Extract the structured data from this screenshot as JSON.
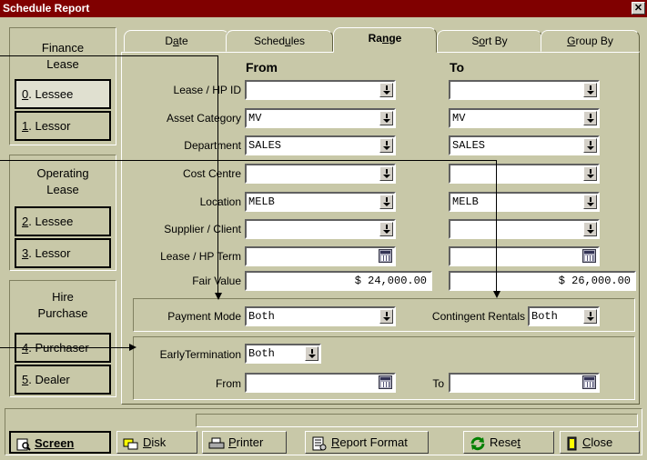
{
  "window": {
    "title": "Schedule Report",
    "close_glyph": "✕"
  },
  "sidebar": {
    "finance": {
      "title_line1": "Finance",
      "title_line2": "Lease",
      "btn1": {
        "key": "0",
        "label": ". Lessee"
      },
      "btn2": {
        "key": "1",
        "label": ". Lessor"
      }
    },
    "operating": {
      "title_line1": "Operating",
      "title_line2": "Lease",
      "btn1": {
        "key": "2",
        "label": ". Lessee"
      },
      "btn2": {
        "key": "3",
        "label": ". Lessor"
      }
    },
    "hire": {
      "title_line1": "Hire",
      "title_line2": "Purchase",
      "btn1": {
        "key": "4",
        "label": ". Purchaser"
      },
      "btn2": {
        "key": "5",
        "label": ". Dealer"
      }
    }
  },
  "tabs": [
    {
      "pre": "D",
      "key": "a",
      "post": "te"
    },
    {
      "pre": "Sched",
      "key": "u",
      "post": "les"
    },
    {
      "pre": "Ra",
      "key": "n",
      "post": "ge"
    },
    {
      "pre": "S",
      "key": "o",
      "post": "rt By"
    },
    {
      "pre": "",
      "key": "G",
      "post": "roup By"
    }
  ],
  "range": {
    "from_header": "From",
    "to_header": "To",
    "rows": [
      {
        "label": "Lease / HP ID",
        "from": "",
        "to": ""
      },
      {
        "label": "Asset Category",
        "from": "MV",
        "to": "MV"
      },
      {
        "label": "Department",
        "from": "SALES",
        "to": "SALES"
      },
      {
        "label": "Cost Centre",
        "from": "",
        "to": ""
      },
      {
        "label": "Location",
        "from": "MELB",
        "to": "MELB"
      },
      {
        "label": "Supplier / Client",
        "from": "",
        "to": ""
      },
      {
        "label": "Lease / HP Term",
        "from": "",
        "to": ""
      },
      {
        "label": "Fair Value",
        "from": "$ 24,000.00",
        "to": "$ 26,000.00"
      }
    ],
    "payment_mode": {
      "label": "Payment Mode",
      "value": "Both"
    },
    "contingent_rentals": {
      "label": "Contingent Rentals",
      "value": "Both"
    },
    "early_termination": {
      "label": "EarlyTermination",
      "value": "Both"
    },
    "from_label": "From",
    "to_label": "To",
    "from_date": "",
    "to_date": ""
  },
  "footer": {
    "screen": "Screen",
    "disk": {
      "key": "D",
      "post": "isk"
    },
    "printer": {
      "key": "P",
      "post": "rinter"
    },
    "report_format": {
      "key": "R",
      "post": "eport Format"
    },
    "reset": {
      "pre": "Rese",
      "key": "t"
    },
    "close": {
      "key": "C",
      "post": "lose"
    }
  }
}
